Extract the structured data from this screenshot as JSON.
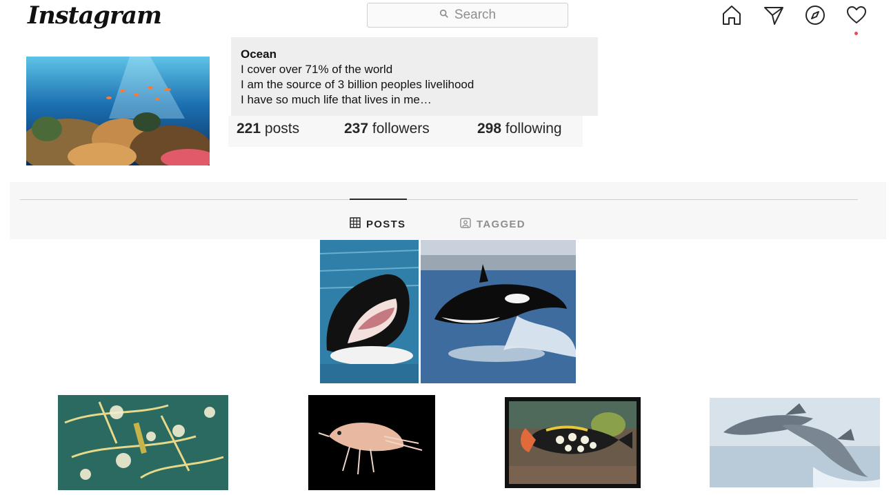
{
  "header": {
    "logo_text": "Instagram",
    "search_placeholder": "Search",
    "icons": [
      "home-icon",
      "direct-message-icon",
      "explore-icon",
      "activity-heart-icon"
    ],
    "notification_dot_color": "#ed4956"
  },
  "profile": {
    "bio_name": "Ocean",
    "bio_lines": [
      "I cover over 71% of the world",
      "I am the source of 3 billion peoples livelihood",
      "I have so much life that lives in me…"
    ],
    "stats": {
      "posts_count": "221",
      "posts_label": "posts",
      "followers_count": "237",
      "followers_label": "followers",
      "following_count": "298",
      "following_label": "following"
    }
  },
  "tabs": [
    {
      "label": "POSTS",
      "icon": "grid-icon",
      "active": true
    },
    {
      "label": "TAGGED",
      "icon": "tagged-icon",
      "active": false
    }
  ],
  "posts": [
    {
      "subject": "orca-open-mouth"
    },
    {
      "subject": "orca-breaching"
    },
    {
      "subject": "plankton"
    },
    {
      "subject": "amphipod"
    },
    {
      "subject": "clown-triggerfish"
    },
    {
      "subject": "dolphins"
    }
  ],
  "colors": {
    "accent_text": "#262626",
    "muted_text": "#8e8e8e",
    "bio_background": "#eeeeee"
  }
}
